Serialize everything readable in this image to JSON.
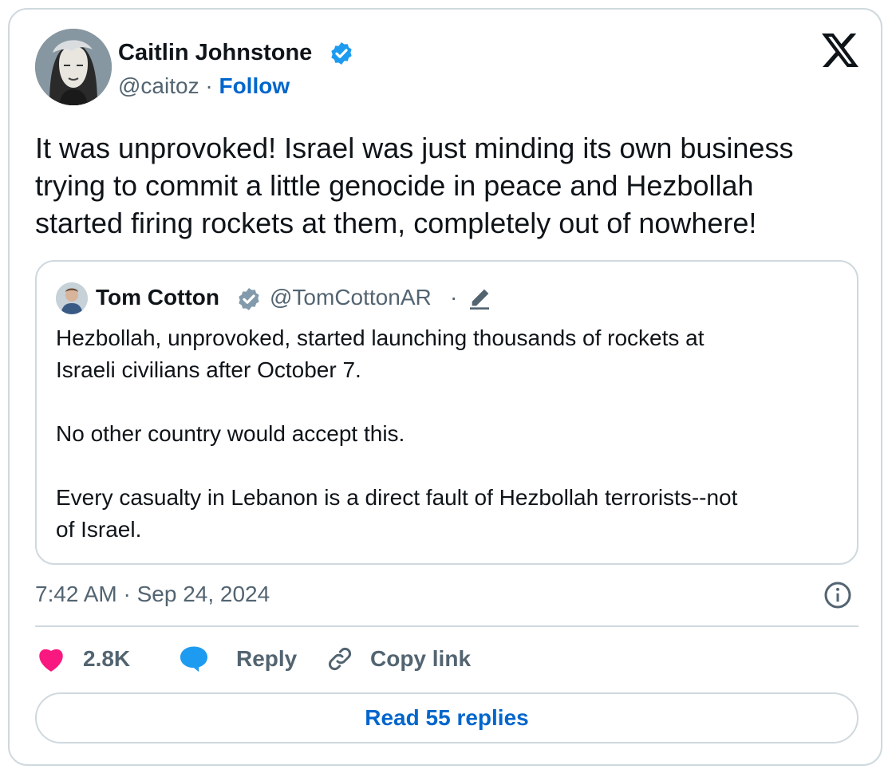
{
  "author": {
    "name": "Caitlin Johnstone",
    "handle": "@caitoz",
    "separator": " · ",
    "follow_label": "Follow"
  },
  "tweet_text": "It was unprovoked! Israel was just minding its own business\ntrying to commit a little genocide in peace and Hezbollah\nstarted firing rockets at them, completely out of nowhere!",
  "quoted": {
    "name": "Tom Cotton",
    "handle": "@TomCottonAR",
    "separator": "·",
    "text": "Hezbollah, unprovoked, started launching thousands of rockets at\nIsraeli civilians after October 7.\n\nNo other country would accept this.\n\nEvery casualty in Lebanon is a direct fault of Hezbollah terrorists--not\nof Israel."
  },
  "timestamp": "7:42 AM · Sep 24, 2024",
  "actions": {
    "like_count": "2.8K",
    "reply_label": "Reply",
    "copy_label": "Copy link"
  },
  "read_replies_label": "Read 55 replies",
  "icons": [
    "x-logo-icon",
    "verified-badge-icon",
    "gray-verified-badge-icon",
    "edit-icon",
    "info-icon",
    "heart-icon",
    "reply-bubble-icon",
    "link-icon"
  ],
  "colors": {
    "accent": "#0066cc",
    "verified_blue": "#1d9bf0",
    "verified_gray": "#829aab",
    "heart": "#f91880",
    "muted_text": "#536471",
    "border": "#cfd9de"
  }
}
